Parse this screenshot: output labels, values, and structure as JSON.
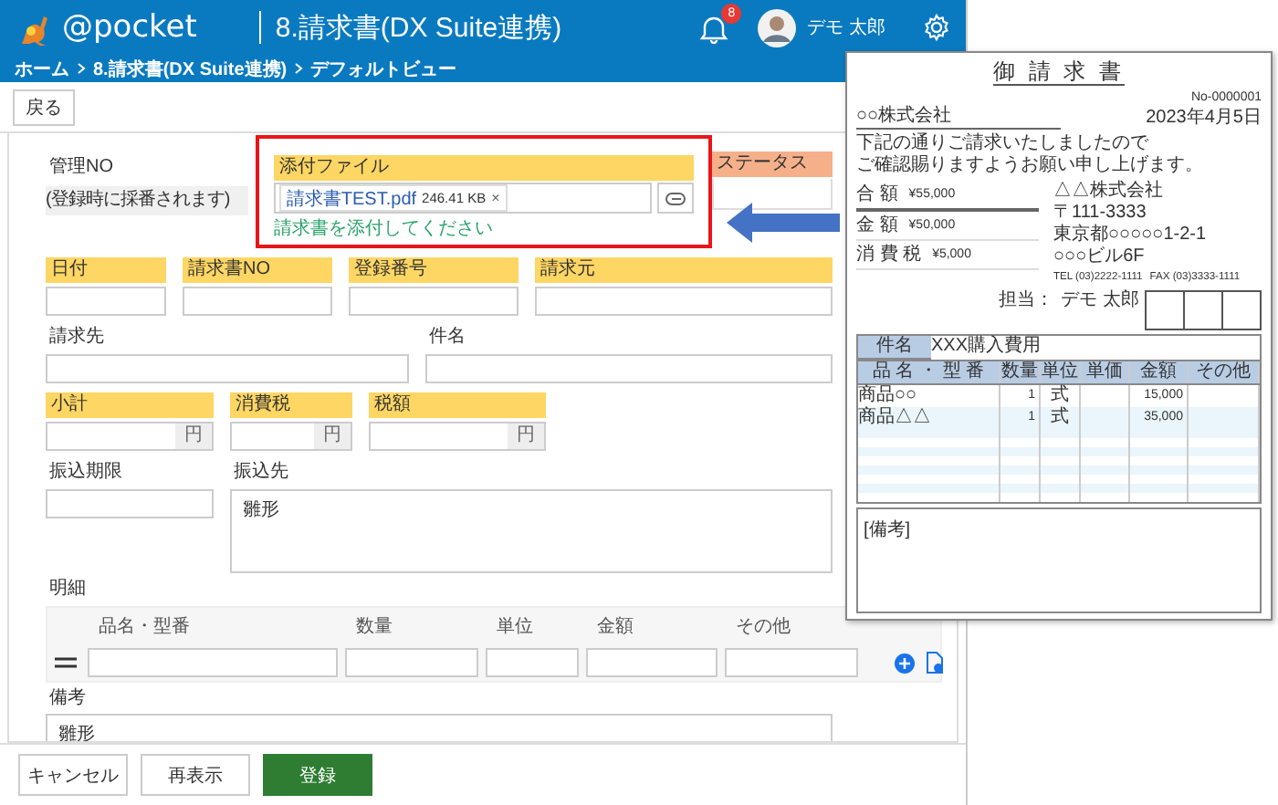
{
  "header": {
    "logo": "@pocket",
    "title": "8.請求書(DX Suite連携)",
    "notification_count": "8",
    "user": "デモ 太郎"
  },
  "breadcrumb": [
    {
      "label": "ホーム"
    },
    {
      "label": "8.請求書(DX Suite連携)"
    },
    {
      "label": "デフォルトビュー"
    }
  ],
  "toolbar": {
    "back_button": "戻る"
  },
  "form": {
    "management_no": {
      "label": "管理NO",
      "value": "(登録時に採番されます)"
    },
    "attachment": {
      "label": "添付ファイル",
      "file_name": "請求書TEST.pdf",
      "file_size": "246.41 KB",
      "remove": "×",
      "hint": "請求書を添付してください",
      "highlighted": true
    },
    "status": {
      "label": "ステータス"
    },
    "rows": [
      [
        {
          "label": "日付",
          "kind": "input",
          "required": true
        },
        {
          "label": "請求書NO",
          "kind": "input",
          "required": true
        },
        {
          "label": "登録番号",
          "kind": "input",
          "required": true
        },
        {
          "label": "請求元",
          "kind": "input",
          "required": true
        }
      ],
      [
        {
          "label": "請求先",
          "kind": "input",
          "required": false
        },
        {
          "label": "件名",
          "kind": "input",
          "required": false
        }
      ],
      [
        {
          "label": "小計",
          "kind": "currency",
          "required": true,
          "unit": "円"
        },
        {
          "label": "消費税",
          "kind": "currency",
          "required": true,
          "unit": "円"
        },
        {
          "label": "税額",
          "kind": "currency",
          "required": true,
          "unit": "円"
        }
      ],
      [
        {
          "label": "振込期限",
          "kind": "input",
          "required": false
        },
        {
          "label": "振込先",
          "kind": "textarea",
          "required": false,
          "value": "雛形"
        }
      ]
    ],
    "details": {
      "label": "明細",
      "columns": [
        "品名・型番",
        "数量",
        "単位",
        "金額",
        "その他"
      ]
    },
    "remarks": {
      "label": "備考",
      "value": "雛形"
    }
  },
  "footer_buttons": [
    {
      "label": "キャンセル",
      "kind": "default"
    },
    {
      "label": "再表示",
      "kind": "default"
    },
    {
      "label": "登録",
      "kind": "primary"
    }
  ],
  "document": {
    "title": "御 請 求 書",
    "number": "No-0000001",
    "date": "2023年4月5日",
    "recipient": "○○株式会社",
    "message": [
      "下記の通りご請求いたしましたので",
      "ご確認賜りますようお願い申し上げます。"
    ],
    "total": {
      "label": "合 額",
      "value": "¥55,000"
    },
    "amounts": [
      {
        "label": "金 額",
        "value": "¥50,000"
      },
      {
        "label": "消 費 税",
        "value": "¥5,000"
      }
    ],
    "issuer": {
      "name": "△△株式会社",
      "postal": "〒111-3333",
      "address": "東京都○○○○○1-2-1",
      "building": "○○○ビル6F",
      "tel": "TEL (03)2222-1111",
      "fax": "FAX (03)3333-1111"
    },
    "person": {
      "label": "担当：",
      "name": "デモ 太郎"
    },
    "subject": {
      "label": "件名",
      "value": "XXX購入費用"
    },
    "columns": [
      "品 名 ・ 型 番",
      "数量",
      "単位",
      "単価",
      "金額",
      "その他"
    ],
    "items": [
      {
        "name": "商品○○",
        "quantity": "1",
        "unit": "式",
        "amount": "15,000"
      },
      {
        "name": "商品△△",
        "quantity": "1",
        "unit": "式",
        "amount": "35,000"
      }
    ],
    "remarks_label": "[備考]"
  }
}
